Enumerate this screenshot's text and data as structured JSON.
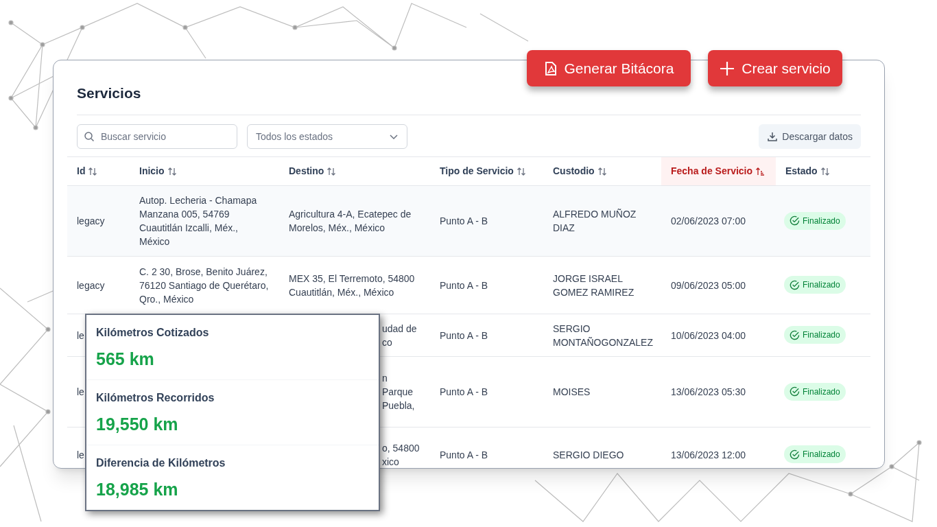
{
  "actions": [
    {
      "kind": "pdf",
      "label": "Generar Bitácora"
    },
    {
      "kind": "add",
      "label": "Crear servicio"
    }
  ],
  "card": {
    "title": "Servicios",
    "search": {
      "placeholder": "Buscar servicio"
    },
    "status_filter": {
      "value": "Todos los estados"
    },
    "download_button": "Descargar datos",
    "table": {
      "columns": [
        {
          "label": "Id",
          "selected": false
        },
        {
          "label": "Inicio",
          "selected": false
        },
        {
          "label": "Destino",
          "selected": false
        },
        {
          "label": "Tipo de Servicio",
          "selected": false
        },
        {
          "label": "Custodio",
          "selected": false
        },
        {
          "label": "Fecha de Servicio",
          "selected": true
        },
        {
          "label": "Estado",
          "selected": false
        }
      ],
      "rows": [
        {
          "id": "legacy",
          "inicio": "Autop. Lecheria - Chamapa Manzana 005, 54769 Cuautitlán Izcalli, Méx., México",
          "destino": "Agricultura 4-A, Ecatepec de Morelos, Méx., México",
          "tipo": "Punto A - B",
          "custodio": "ALFREDO MUÑOZ DIAZ",
          "fecha": "02/06/2023 07:00",
          "estado": "Finalizado"
        },
        {
          "id": "legacy",
          "inicio": "C. 2 30, Brose, Benito Juárez, 76120 Santiago de Querétaro, Qro., México",
          "destino": "MEX 35, El Terremoto, 54800 Cuautitlán, Méx., México",
          "tipo": "Punto A - B",
          "custodio": "JORGE ISRAEL GOMEZ RAMIREZ",
          "fecha": "09/06/2023 05:00",
          "estado": "Finalizado"
        },
        {
          "id": "le",
          "destino": "udad de\nco",
          "tipo": "Punto A - B",
          "custodio": "SERGIO MONTAÑOGONZALEZ",
          "fecha": "10/06/2023 04:00",
          "estado": "Finalizado"
        },
        {
          "id": "le",
          "destino": "n\nParque\nPuebla,",
          "tipo": "Punto A - B",
          "custodio": "MOISES",
          "fecha": "13/06/2023 05:30",
          "estado": "Finalizado"
        },
        {
          "id": "le",
          "destino": "o, 54800\nxico",
          "tipo": "Punto A - B",
          "custodio": "SERGIO DIEGO",
          "fecha": "13/06/2023 12:00",
          "estado": "Finalizado"
        }
      ]
    }
  },
  "summary": [
    {
      "label": "Kilómetros Cotizados",
      "value": "565 km"
    },
    {
      "label": "Kilómetros Recorridos",
      "value": "19,550 km"
    },
    {
      "label": "Diferencia de Kilómetros",
      "value": "18,985 km"
    }
  ]
}
